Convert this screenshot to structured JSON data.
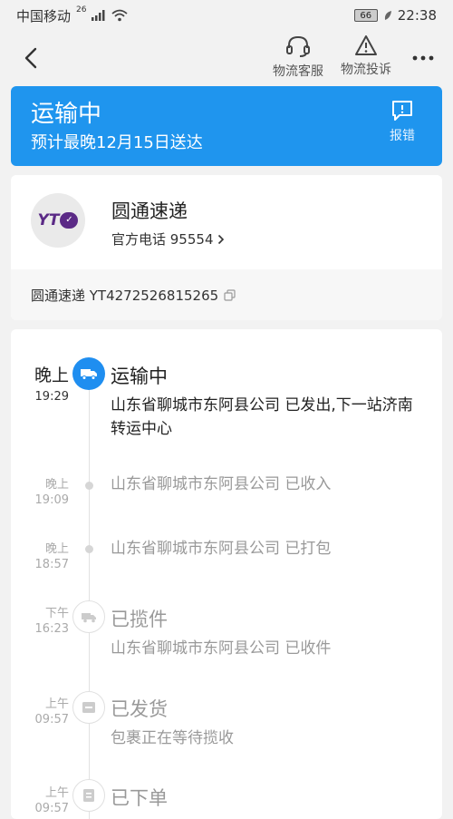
{
  "status_bar": {
    "carrier": "中国移动",
    "network": "26",
    "battery": "66",
    "time": "22:38"
  },
  "header": {
    "back_icon": "chevron-left-icon",
    "actions": [
      {
        "label": "物流客服",
        "icon": "headset-icon"
      },
      {
        "label": "物流投诉",
        "icon": "warning-icon"
      }
    ],
    "more_icon": "more-icon"
  },
  "banner": {
    "title": "运输中",
    "subtitle": "预计最晚12月15日送达",
    "report_label": "报错",
    "color": "#1f95ee"
  },
  "courier": {
    "logo_text": "YT",
    "name": "圆通速递",
    "phone": "官方电话 95554",
    "tracking": "圆通速递 YT4272526815265"
  },
  "timeline": [
    {
      "time_top": "晚上",
      "time_bot": "19:29",
      "title": "运输中",
      "detail": "山东省聊城市东阿县公司 已发出,下一站济南转运中心",
      "active": true
    },
    {
      "time_top": "晚上",
      "time_bot": "19:09",
      "title": "",
      "detail": "山东省聊城市东阿县公司 已收入"
    },
    {
      "time_top": "晚上",
      "time_bot": "18:57",
      "title": "",
      "detail": "山东省聊城市东阿县公司 已打包"
    },
    {
      "time_top": "下午",
      "time_bot": "16:23",
      "title": "已揽件",
      "detail": "山东省聊城市东阿县公司 已收件",
      "icon": "pickup-truck-icon"
    },
    {
      "time_top": "上午",
      "time_bot": "09:57",
      "title": "已发货",
      "detail": "包裹正在等待揽收",
      "icon": "package-icon"
    },
    {
      "time_top": "上午",
      "time_bot": "09:57",
      "title": "已下单",
      "detail": "",
      "icon": "order-icon"
    }
  ]
}
